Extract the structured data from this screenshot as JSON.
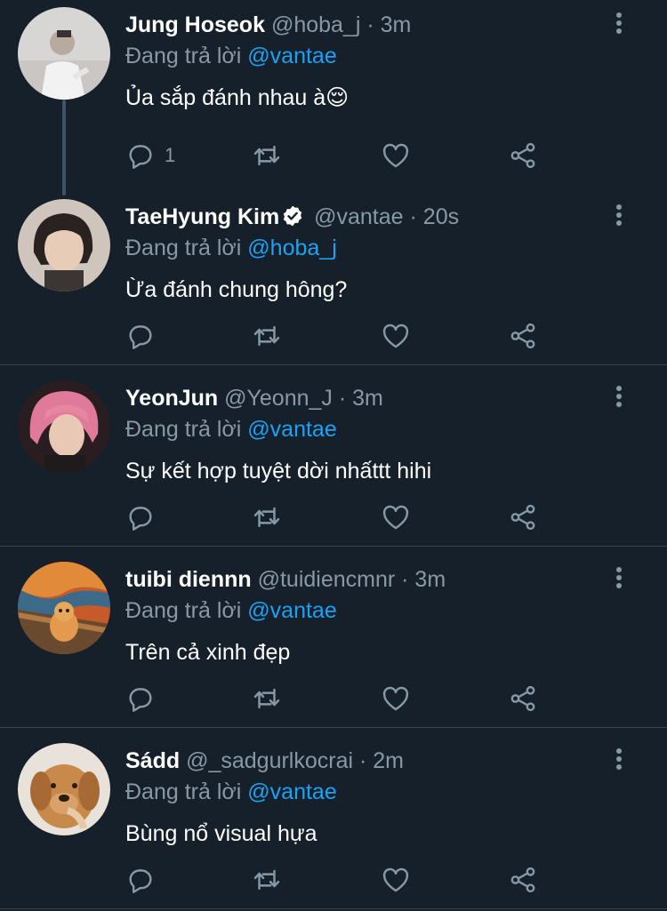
{
  "colors": {
    "background": "#15202b",
    "divider": "#38444d",
    "secondary_text": "#8899a6",
    "mention": "#1da1f2",
    "primary_text": "#ffffff"
  },
  "replying_prefix": "Đang trả lời",
  "tweets": [
    {
      "name": "Jung Hoseok",
      "handle": "@hoba_j",
      "time": "3m",
      "verified": false,
      "replying_to": "@vantae",
      "text": "Ủa sắp đánh nhau à😌",
      "reply_count": "1",
      "avatar_icon": "person-white-shirt-avatar"
    },
    {
      "name": "TaeHyung Kim",
      "handle": "@vantae",
      "time": "20s",
      "verified": true,
      "replying_to": "@hoba_j",
      "text": "Ừa đánh chung hông?",
      "reply_count": "",
      "avatar_icon": "person-dark-hair-avatar"
    },
    {
      "name": "YeonJun",
      "handle": "@Yeonn_J",
      "time": "3m",
      "verified": false,
      "replying_to": "@vantae",
      "text": "Sự kết hợp tuyệt dời nhấttt hihi",
      "reply_count": "",
      "avatar_icon": "person-pink-hair-avatar"
    },
    {
      "name": "tuibi diennn",
      "handle": "@tuidiencmnr",
      "time": "3m",
      "verified": false,
      "replying_to": "@vantae",
      "text": "Trên cả xinh đẹp",
      "reply_count": "",
      "avatar_icon": "scream-painting-cat-avatar"
    },
    {
      "name": "Sádd",
      "handle": "@_sadgurlkocrai",
      "time": "2m",
      "verified": false,
      "replying_to": "@vantae",
      "text": "Bùng nổ visual hựa",
      "reply_count": "",
      "avatar_icon": "golden-dog-avatar"
    }
  ]
}
